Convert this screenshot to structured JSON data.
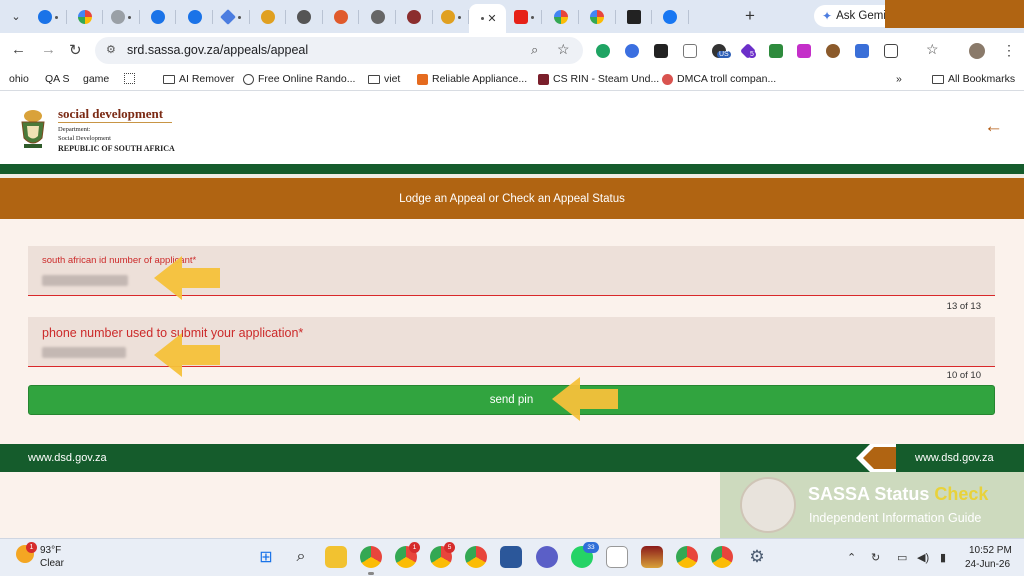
{
  "browser": {
    "active_tab_close": "✕",
    "tab_favicon_colors": [
      "#1a73e8",
      "#e8453c",
      "#9aa0a6",
      "#1a73e8",
      "#1a73e8",
      "#4c7de0",
      "#e0a020",
      "#555",
      "#e05a2b",
      "#666",
      "#8b2e2e",
      "#e0a020",
      "#fff",
      "#e62117",
      "#4285f4",
      "#4285f4",
      "#222",
      "#1877f2"
    ],
    "new_tab": "+",
    "gemini_label": "Ask Gemini",
    "url": "srd.sassa.gov.za/appeals/appeal",
    "bookmarks": [
      {
        "label": "ohio"
      },
      {
        "label": "QA S"
      },
      {
        "label": "game"
      },
      {
        "label": "AI Remover"
      },
      {
        "label": "Free Online Rando..."
      },
      {
        "label": "viet"
      },
      {
        "label": "Reliable Appliance..."
      },
      {
        "label": "CS RIN - Steam Und..."
      },
      {
        "label": "DMCA troll compan..."
      }
    ],
    "bookmarks_overflow": "»",
    "all_bookmarks": "All Bookmarks",
    "extension_badge_1": "US",
    "extension_badge_2": "5"
  },
  "site": {
    "department_title": "social development",
    "department_label": "Department:",
    "department_name": "Social Development",
    "country": "REPUBLIC OF SOUTH AFRICA",
    "page_title": "Lodge an Appeal or Check an Appeal Status",
    "colors": {
      "green": "#155c2c",
      "orange": "#b06412",
      "button": "#31a43f",
      "error": "#cc2a2a"
    }
  },
  "form": {
    "id_label": "south african id number of applicant*",
    "id_counter": "13 of 13",
    "phone_label": "phone number used to submit your application*",
    "phone_counter": "10 of 10",
    "send_pin_label": "send pin"
  },
  "footer": {
    "left_link": "www.dsd.gov.za",
    "right_link": "www.dsd.gov.za"
  },
  "watermark": {
    "title_main": "SASSA Status ",
    "title_accent": "Check",
    "subtitle": "Independent Information Guide"
  },
  "taskbar": {
    "weather_badge": "1",
    "temperature": "93°F",
    "condition": "Clear",
    "badges": {
      "chrome2": "1",
      "chrome3": "5",
      "whatsapp": "33"
    },
    "time": "10:52 PM",
    "date": "24-Jun-26"
  }
}
